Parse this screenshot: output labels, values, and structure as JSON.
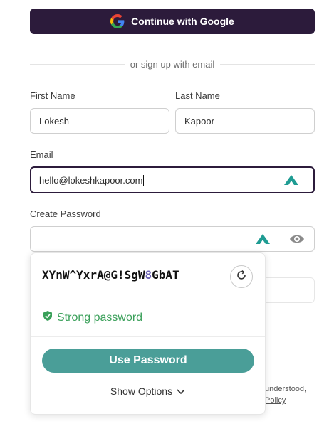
{
  "google_button": {
    "label": "Continue with Google"
  },
  "divider": {
    "text": "or sign up with email"
  },
  "form": {
    "first_name": {
      "label": "First Name",
      "value": "Lokesh"
    },
    "last_name": {
      "label": "Last Name",
      "value": "Kapoor"
    },
    "email": {
      "label": "Email",
      "value": "hello@lokeshkapoor.com"
    },
    "password": {
      "label": "Create Password",
      "value": ""
    }
  },
  "background_text": {
    "line1": "understood,",
    "link": "Policy"
  },
  "password_popup": {
    "generated_password_part1": "XYnW^YxrA@G!SgW",
    "generated_password_digit": "8",
    "generated_password_part2": "GbAT",
    "strength_label": "Strong password",
    "use_button": "Use Password",
    "show_options": "Show Options"
  },
  "colors": {
    "primary_dark": "#2c1b3b",
    "nordpass_teal": "#1f9c93",
    "use_button": "#4a9e98",
    "strong_green": "#3aa05a",
    "digit_highlight": "#6c63b5"
  },
  "icons": [
    "google-icon",
    "nordpass-icon",
    "eye-icon",
    "refresh-icon",
    "shield-check-icon",
    "chevron-down-icon"
  ]
}
